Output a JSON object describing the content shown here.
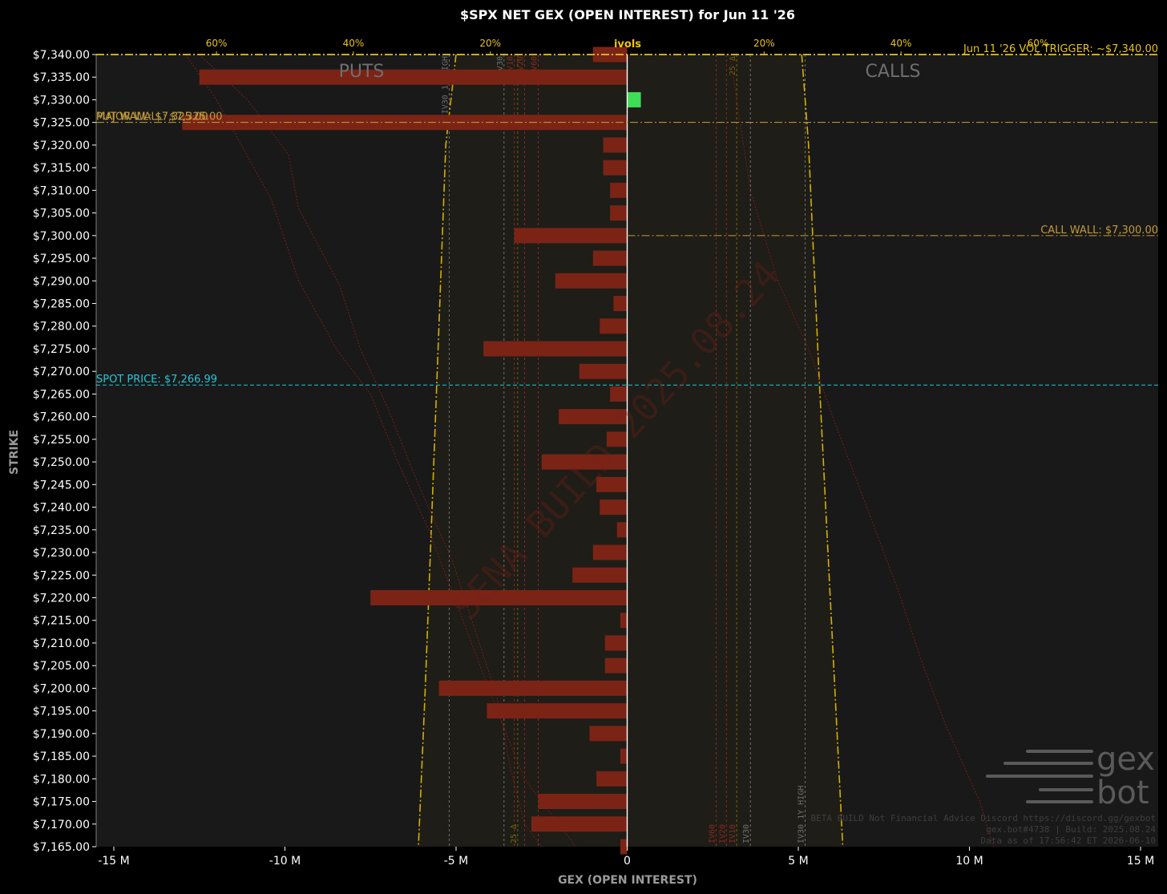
{
  "chart_data": {
    "type": "bar",
    "orientation": "horizontal",
    "title": "$SPX NET GEX (OPEN INTEREST) for Jun 11 '26",
    "xlabel": "GEX (OPEN INTEREST)",
    "ylabel": "STRIKE",
    "xlim": [
      -15.5,
      15.5
    ],
    "ylim": [
      7165,
      7340
    ],
    "x_ticks": [
      -15,
      -10,
      -5,
      0,
      5,
      10,
      15
    ],
    "x_tick_labels": [
      "-15 M",
      "-10 M",
      "-5 M",
      "0",
      "5 M",
      "10 M",
      "15 M"
    ],
    "strike_tick_labels": [
      "$7,340.00",
      "$7,335.00",
      "$7,330.00",
      "$7,325.00",
      "$7,320.00",
      "$7,315.00",
      "$7,310.00",
      "$7,305.00",
      "$7,300.00",
      "$7,295.00",
      "$7,290.00",
      "$7,285.00",
      "$7,280.00",
      "$7,275.00",
      "$7,270.00",
      "$7,265.00",
      "$7,260.00",
      "$7,255.00",
      "$7,250.00",
      "$7,245.00",
      "$7,240.00",
      "$7,235.00",
      "$7,230.00",
      "$7,225.00",
      "$7,220.00",
      "$7,215.00",
      "$7,210.00",
      "$7,205.00",
      "$7,200.00",
      "$7,195.00",
      "$7,190.00",
      "$7,185.00",
      "$7,180.00",
      "$7,175.00",
      "$7,170.00",
      "$7,165.00"
    ],
    "strikes": [
      7340,
      7335,
      7330,
      7325,
      7320,
      7315,
      7310,
      7305,
      7300,
      7295,
      7290,
      7285,
      7280,
      7275,
      7270,
      7265,
      7260,
      7255,
      7250,
      7245,
      7240,
      7235,
      7230,
      7225,
      7220,
      7215,
      7210,
      7205,
      7200,
      7195,
      7190,
      7185,
      7180,
      7175,
      7170,
      7165
    ],
    "values": [
      -1.0,
      -12.5,
      0.4,
      -13.0,
      -0.7,
      -0.7,
      -0.5,
      -0.5,
      -3.3,
      -1.0,
      -2.1,
      -0.4,
      -0.8,
      -4.2,
      -1.4,
      -0.5,
      -2.0,
      -0.6,
      -2.5,
      -0.9,
      -0.8,
      -0.3,
      -1.0,
      -1.6,
      -7.5,
      -0.2,
      -0.65,
      -0.65,
      -5.5,
      -4.1,
      -1.1,
      -0.2,
      -0.9,
      -2.6,
      -2.8,
      -0.2
    ],
    "bar_colors": {
      "negative": "#7b2416",
      "positive": "#3fdc55"
    },
    "ivols_axis": {
      "label": "ivols",
      "ticks": [
        {
          "x": -12,
          "label": "60%"
        },
        {
          "x": -8,
          "label": "40%"
        },
        {
          "x": -4,
          "label": "20%"
        },
        {
          "x": 4,
          "label": "20%"
        },
        {
          "x": 8,
          "label": "40%"
        },
        {
          "x": 12,
          "label": "60%"
        }
      ]
    },
    "side_labels": {
      "puts": "PUTS",
      "calls": "CALLS"
    },
    "levels": [
      {
        "label": "Jun 11 '26 VOL TRIGGER: ~$7,340.00",
        "strike": 7340,
        "color": "#e8c21a",
        "style": "dashdot"
      },
      {
        "label": "PUT WALL: $7,325.00",
        "strike": 7325,
        "color": "#c2a23a",
        "style": "dashdot"
      },
      {
        "label": "MAJOR WALL: $7,325.00",
        "strike": 7325,
        "color": "#c29a3a",
        "style": "dashdot"
      },
      {
        "label": "CALL WALL: $7,300.00",
        "strike": 7300,
        "color": "#c29a3a",
        "style": "dashdot"
      },
      {
        "label": "SPOT PRICE: $7,266.99",
        "strike": 7266.99,
        "color": "#27c6d6",
        "style": "dashed"
      }
    ],
    "vertical_lines": [
      {
        "x": -5.2,
        "label": "IV30 1Y HIGH",
        "color": "#707070",
        "label_at": "top"
      },
      {
        "x": -3.6,
        "label": "IV30",
        "color": "#707070",
        "label_at": "top"
      },
      {
        "x": -3.3,
        "label": "IV10",
        "color": "#8a2a20",
        "label_at": "top"
      },
      {
        "x": -3.0,
        "label": "IV20",
        "color": "#8a2a20",
        "label_at": "top"
      },
      {
        "x": -2.6,
        "label": "IV60",
        "color": "#8a2a20",
        "label_at": "top"
      },
      {
        "x": -3.2,
        "label": "25 Δ",
        "color": "#6b6210",
        "label_at": "bottom"
      },
      {
        "x": 2.6,
        "label": "IV60",
        "color": "#8a2a20",
        "label_at": "bottom"
      },
      {
        "x": 2.9,
        "label": "IV20",
        "color": "#8a2a20",
        "label_at": "bottom"
      },
      {
        "x": 3.2,
        "label": "IV10",
        "color": "#8a2a20",
        "label_at": "bottom"
      },
      {
        "x": 3.6,
        "label": "IV30",
        "color": "#707070",
        "label_at": "bottom"
      },
      {
        "x": 3.2,
        "label": "25 Δ",
        "color": "#6b6210",
        "label_at": "top"
      },
      {
        "x": 5.2,
        "label": "IV30 1Y HIGH",
        "color": "#707070",
        "label_at": "bottom"
      }
    ],
    "ivol_curves": {
      "put_boundary": [
        [
          -5.0,
          7340
        ],
        [
          -5.3,
          7320
        ],
        [
          -5.9,
          7200
        ],
        [
          -6.1,
          7165
        ]
      ],
      "call_boundary": [
        [
          5.1,
          7340
        ],
        [
          5.3,
          7320
        ],
        [
          5.6,
          7270
        ],
        [
          6.3,
          7165
        ]
      ],
      "put_skew_a": [
        [
          -12.9,
          7340
        ],
        [
          -12.0,
          7330
        ],
        [
          -10.4,
          7308
        ],
        [
          -9.6,
          7290
        ],
        [
          -8.5,
          7275
        ],
        [
          -7.5,
          7265
        ],
        [
          -6.7,
          7250
        ],
        [
          -5.8,
          7235
        ],
        [
          -4.8,
          7215
        ],
        [
          -3.8,
          7195
        ],
        [
          -3.0,
          7180
        ],
        [
          -1.5,
          7165
        ]
      ],
      "put_skew_b": [
        [
          -12.5,
          7340
        ],
        [
          -11.1,
          7330
        ],
        [
          -9.9,
          7318
        ],
        [
          -9.6,
          7306
        ],
        [
          -8.4,
          7289
        ],
        [
          -7.8,
          7275
        ],
        [
          -7.0,
          7262
        ],
        [
          -6.1,
          7245
        ],
        [
          -5.1,
          7228
        ],
        [
          -3.8,
          7198
        ],
        [
          -3.4,
          7182
        ],
        [
          -3.0,
          7170
        ],
        [
          -2.5,
          7165
        ]
      ],
      "call_skew": [
        [
          3.0,
          7340
        ],
        [
          3.2,
          7330
        ],
        [
          3.6,
          7310
        ],
        [
          4.4,
          7290
        ],
        [
          5.3,
          7275
        ],
        [
          6.1,
          7258
        ],
        [
          7.0,
          7240
        ],
        [
          7.9,
          7222
        ],
        [
          8.6,
          7206
        ],
        [
          9.3,
          7192
        ],
        [
          10.3,
          7175
        ],
        [
          10.7,
          7165
        ]
      ]
    },
    "watermark": "SENA BUILD 2025.08.24",
    "grid": false
  },
  "footer": {
    "line1": "BETA BUILD Not Financial Advice Discord https://discord.gg/gexbot",
    "line2": "gex.bot#4738 | Build: 2025.08.24",
    "line3": "Data as of 17:56:42 ET 2026-06-10"
  },
  "logo": {
    "top": "gex",
    "bottom": "bot"
  },
  "colors": {
    "background": "#000000",
    "plot_bg": "#191919",
    "ivol_band": "#1e1d17",
    "boundary": "#d4b000",
    "zero_line": "#ffffff"
  }
}
